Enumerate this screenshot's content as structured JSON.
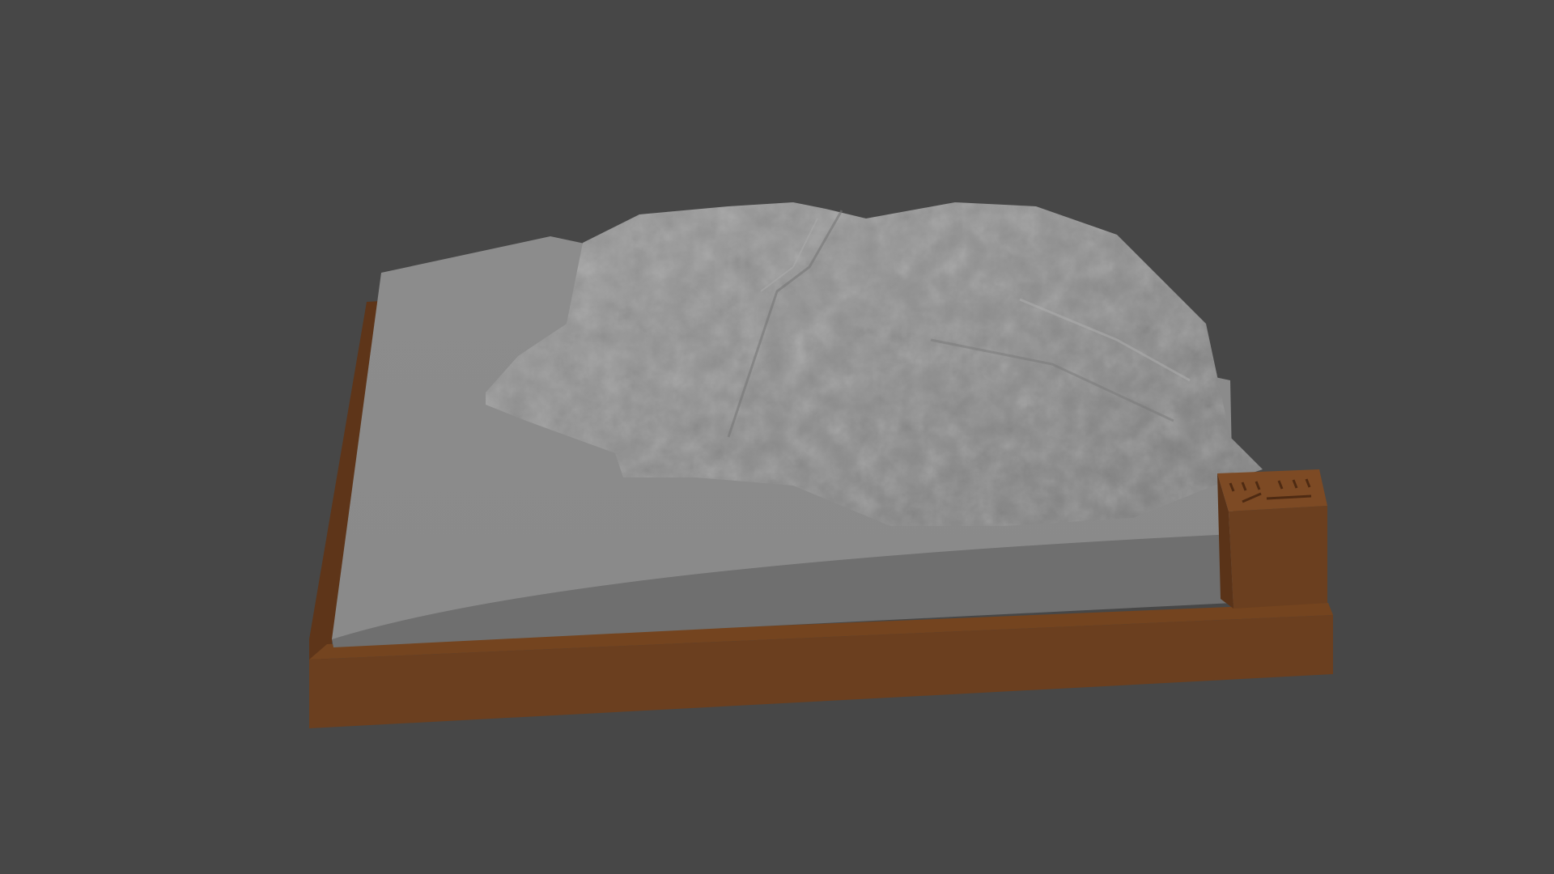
{
  "scene": {
    "background_color": "#474747",
    "base_color": "#6b3f1f",
    "terrain_color": "#8f8f8f",
    "label_block_color": "#7a4722"
  }
}
